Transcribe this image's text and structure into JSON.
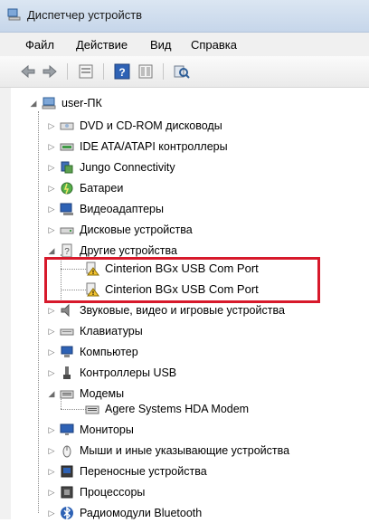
{
  "window": {
    "title": "Диспетчер устройств"
  },
  "menu": [
    "Файл",
    "Действие",
    "Вид",
    "Справка"
  ],
  "toolbar": {
    "buttons": [
      "back-icon",
      "forward-icon",
      "properties-icon",
      "help-icon",
      "view-icon",
      "scan-hardware-icon"
    ]
  },
  "tree": {
    "root": "user-ПК",
    "items": [
      {
        "label": "DVD и CD-ROM дисководы",
        "icon": "dvd-drive-icon"
      },
      {
        "label": "IDE ATA/ATAPI контроллеры",
        "icon": "ide-controller-icon"
      },
      {
        "label": "Jungo Connectivity",
        "icon": "jungo-icon"
      },
      {
        "label": "Батареи",
        "icon": "battery-icon"
      },
      {
        "label": "Видеоадаптеры",
        "icon": "display-adapter-icon"
      },
      {
        "label": "Дисковые устройства",
        "icon": "disk-drive-icon"
      },
      {
        "label": "Другие устройства",
        "icon": "unknown-device-icon",
        "expanded": true,
        "children": [
          {
            "label": "Cinterion BGx USB Com Port",
            "icon": "warning-device-icon"
          },
          {
            "label": "Cinterion BGx USB Com Port",
            "icon": "warning-device-icon"
          }
        ]
      },
      {
        "label": "Звуковые, видео и игровые устройства",
        "icon": "sound-icon"
      },
      {
        "label": "Клавиатуры",
        "icon": "keyboard-icon"
      },
      {
        "label": "Компьютер",
        "icon": "computer-icon"
      },
      {
        "label": "Контроллеры USB",
        "icon": "usb-icon"
      },
      {
        "label": "Модемы",
        "icon": "modem-icon",
        "expanded": true,
        "children": [
          {
            "label": "Agere Systems HDA Modem",
            "icon": "modem-icon"
          }
        ]
      },
      {
        "label": "Мониторы",
        "icon": "monitor-icon"
      },
      {
        "label": "Мыши и иные указывающие устройства",
        "icon": "mouse-icon"
      },
      {
        "label": "Переносные устройства",
        "icon": "portable-device-icon"
      },
      {
        "label": "Процессоры",
        "icon": "processor-icon"
      },
      {
        "label": "Радиомодули Bluetooth",
        "icon": "bluetooth-icon"
      }
    ]
  },
  "colors": {
    "highlight": "#d7192b",
    "warning": "#f2c230"
  }
}
